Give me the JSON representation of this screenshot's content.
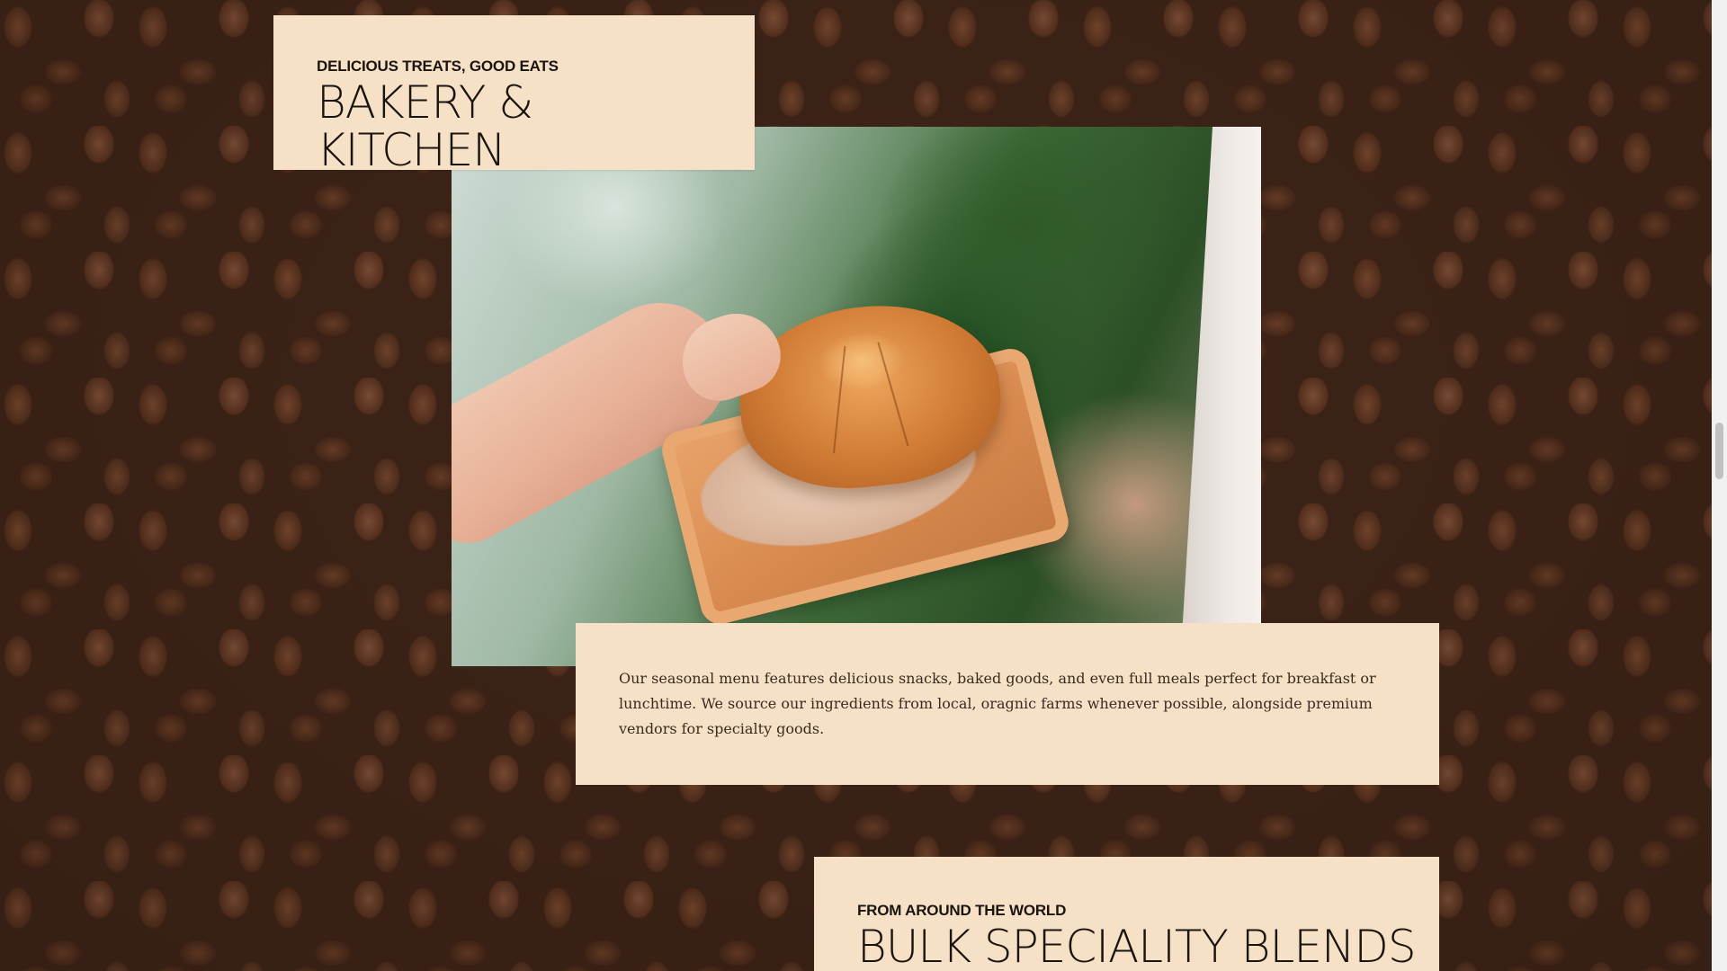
{
  "intro": {
    "eyebrow": "DELICIOUS TREATS, GOOD EATS",
    "heading": "BAKERY & KITCHEN"
  },
  "photo": {
    "subject": "croissant-on-wooden-tray"
  },
  "description": {
    "text": "Our seasonal menu features delicious snacks, baked goods, and even full meals perfect for breakfast or lunchtime. We source our ingredients from local, oragnic farms whenever possible, alongside premium vendors for specialty goods."
  },
  "blends": {
    "eyebrow": "FROM AROUND THE WORLD",
    "heading": "BULK SPECIALITY BLENDS"
  },
  "colors": {
    "panel_background": "#f6e1c6",
    "page_background": "#3e2418",
    "heading_text": "#1a1410",
    "body_text": "#3a2a20"
  }
}
